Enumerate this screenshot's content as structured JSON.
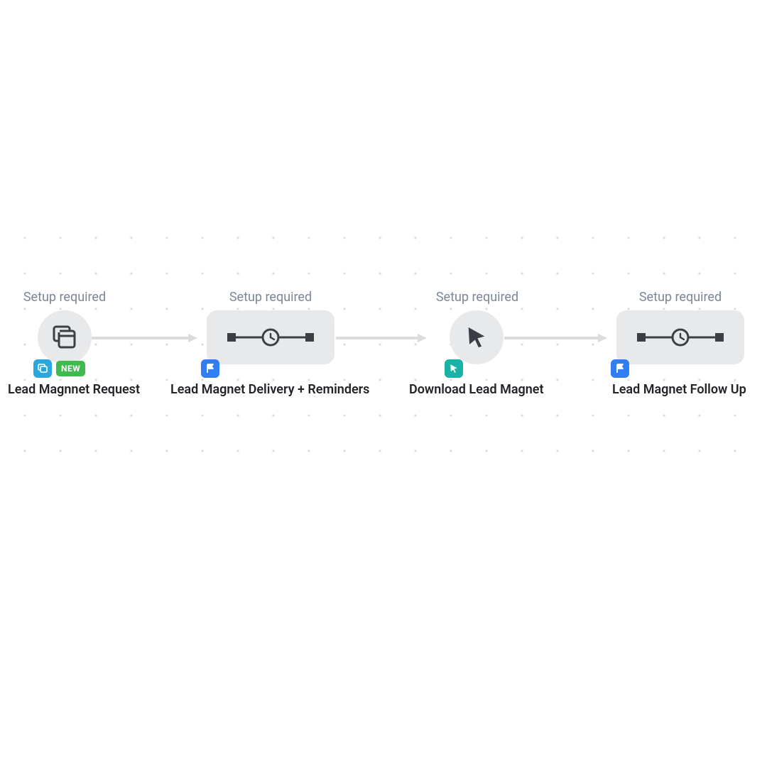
{
  "hint": "Setup required",
  "badge_new": "NEW",
  "nodes": [
    {
      "title": "Lead Magnnet Request"
    },
    {
      "title": "Lead Magnet Delivery + Reminders"
    },
    {
      "title": "Download Lead Magnet"
    },
    {
      "title": "Lead Magnet Follow Up"
    }
  ],
  "colors": {
    "hint": "#7b8795",
    "node_bg": "#e8e9eb",
    "arrow": "#dbdcde",
    "badge_sky": "#2aa7df",
    "badge_blue": "#2f7ef6",
    "badge_teal": "#18b3a4",
    "badge_new": "#3fba4e",
    "icon_dark": "#3b3f45"
  }
}
